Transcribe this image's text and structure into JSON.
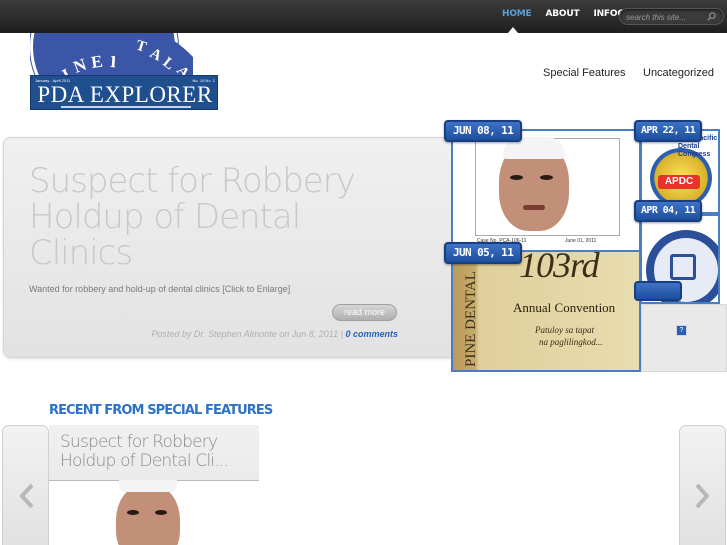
{
  "nav": {
    "items": [
      {
        "label": "HOME",
        "active": true
      },
      {
        "label": "ABOUT",
        "active": false
      },
      {
        "label": "INFOCOM",
        "active": false
      }
    ],
    "search_placeholder": "search this site..."
  },
  "logo": {
    "title": "PDA EXPLORER",
    "issue_left": "January - April 2011",
    "issue_right": "No. 10 No. 1"
  },
  "categories": [
    "Special Features",
    "Uncategorized"
  ],
  "featured": {
    "title": "Suspect for Robbery Holdup of Dental Clinics",
    "excerpt": "Wanted for robbery and hold-up of dental clinics [Click to Enlarge]",
    "read_more": "read more",
    "meta_prefix": "Posted by Dr. Stephen Almonte on Jun 8, 2011",
    "meta_sep": " | ",
    "comments": "0 comments"
  },
  "thumbnails": [
    {
      "date": "JUN 08, 11",
      "caption_left": "Case No. PCA-106-11",
      "caption_right": "June 01, 2011"
    },
    {
      "date": "APR 22, 11",
      "caption": "Asia Pacific Dental Congress",
      "badge": "APDC"
    },
    {
      "date": "APR 04, 11"
    },
    {
      "date": "JUN 05, 11",
      "number": "103rd",
      "heading": "Annual Convention",
      "motto1": "Patuloy sa tapat",
      "motto2": "na paglilingkod..."
    }
  ],
  "recent": {
    "heading": "RECENT FROM SPECIAL FEATURES",
    "card_title": "Suspect for Robbery Holdup of Dental Cli..."
  },
  "colors": {
    "nav_active": "#5d9fd4",
    "accent_blue": "#2f72c4",
    "tag_blue": "#2c5fb3",
    "comments_link": "#2a64b5"
  },
  "icons": {
    "search": "magnifier-icon",
    "prev": "chevron-left-icon",
    "next": "chevron-right-icon"
  }
}
